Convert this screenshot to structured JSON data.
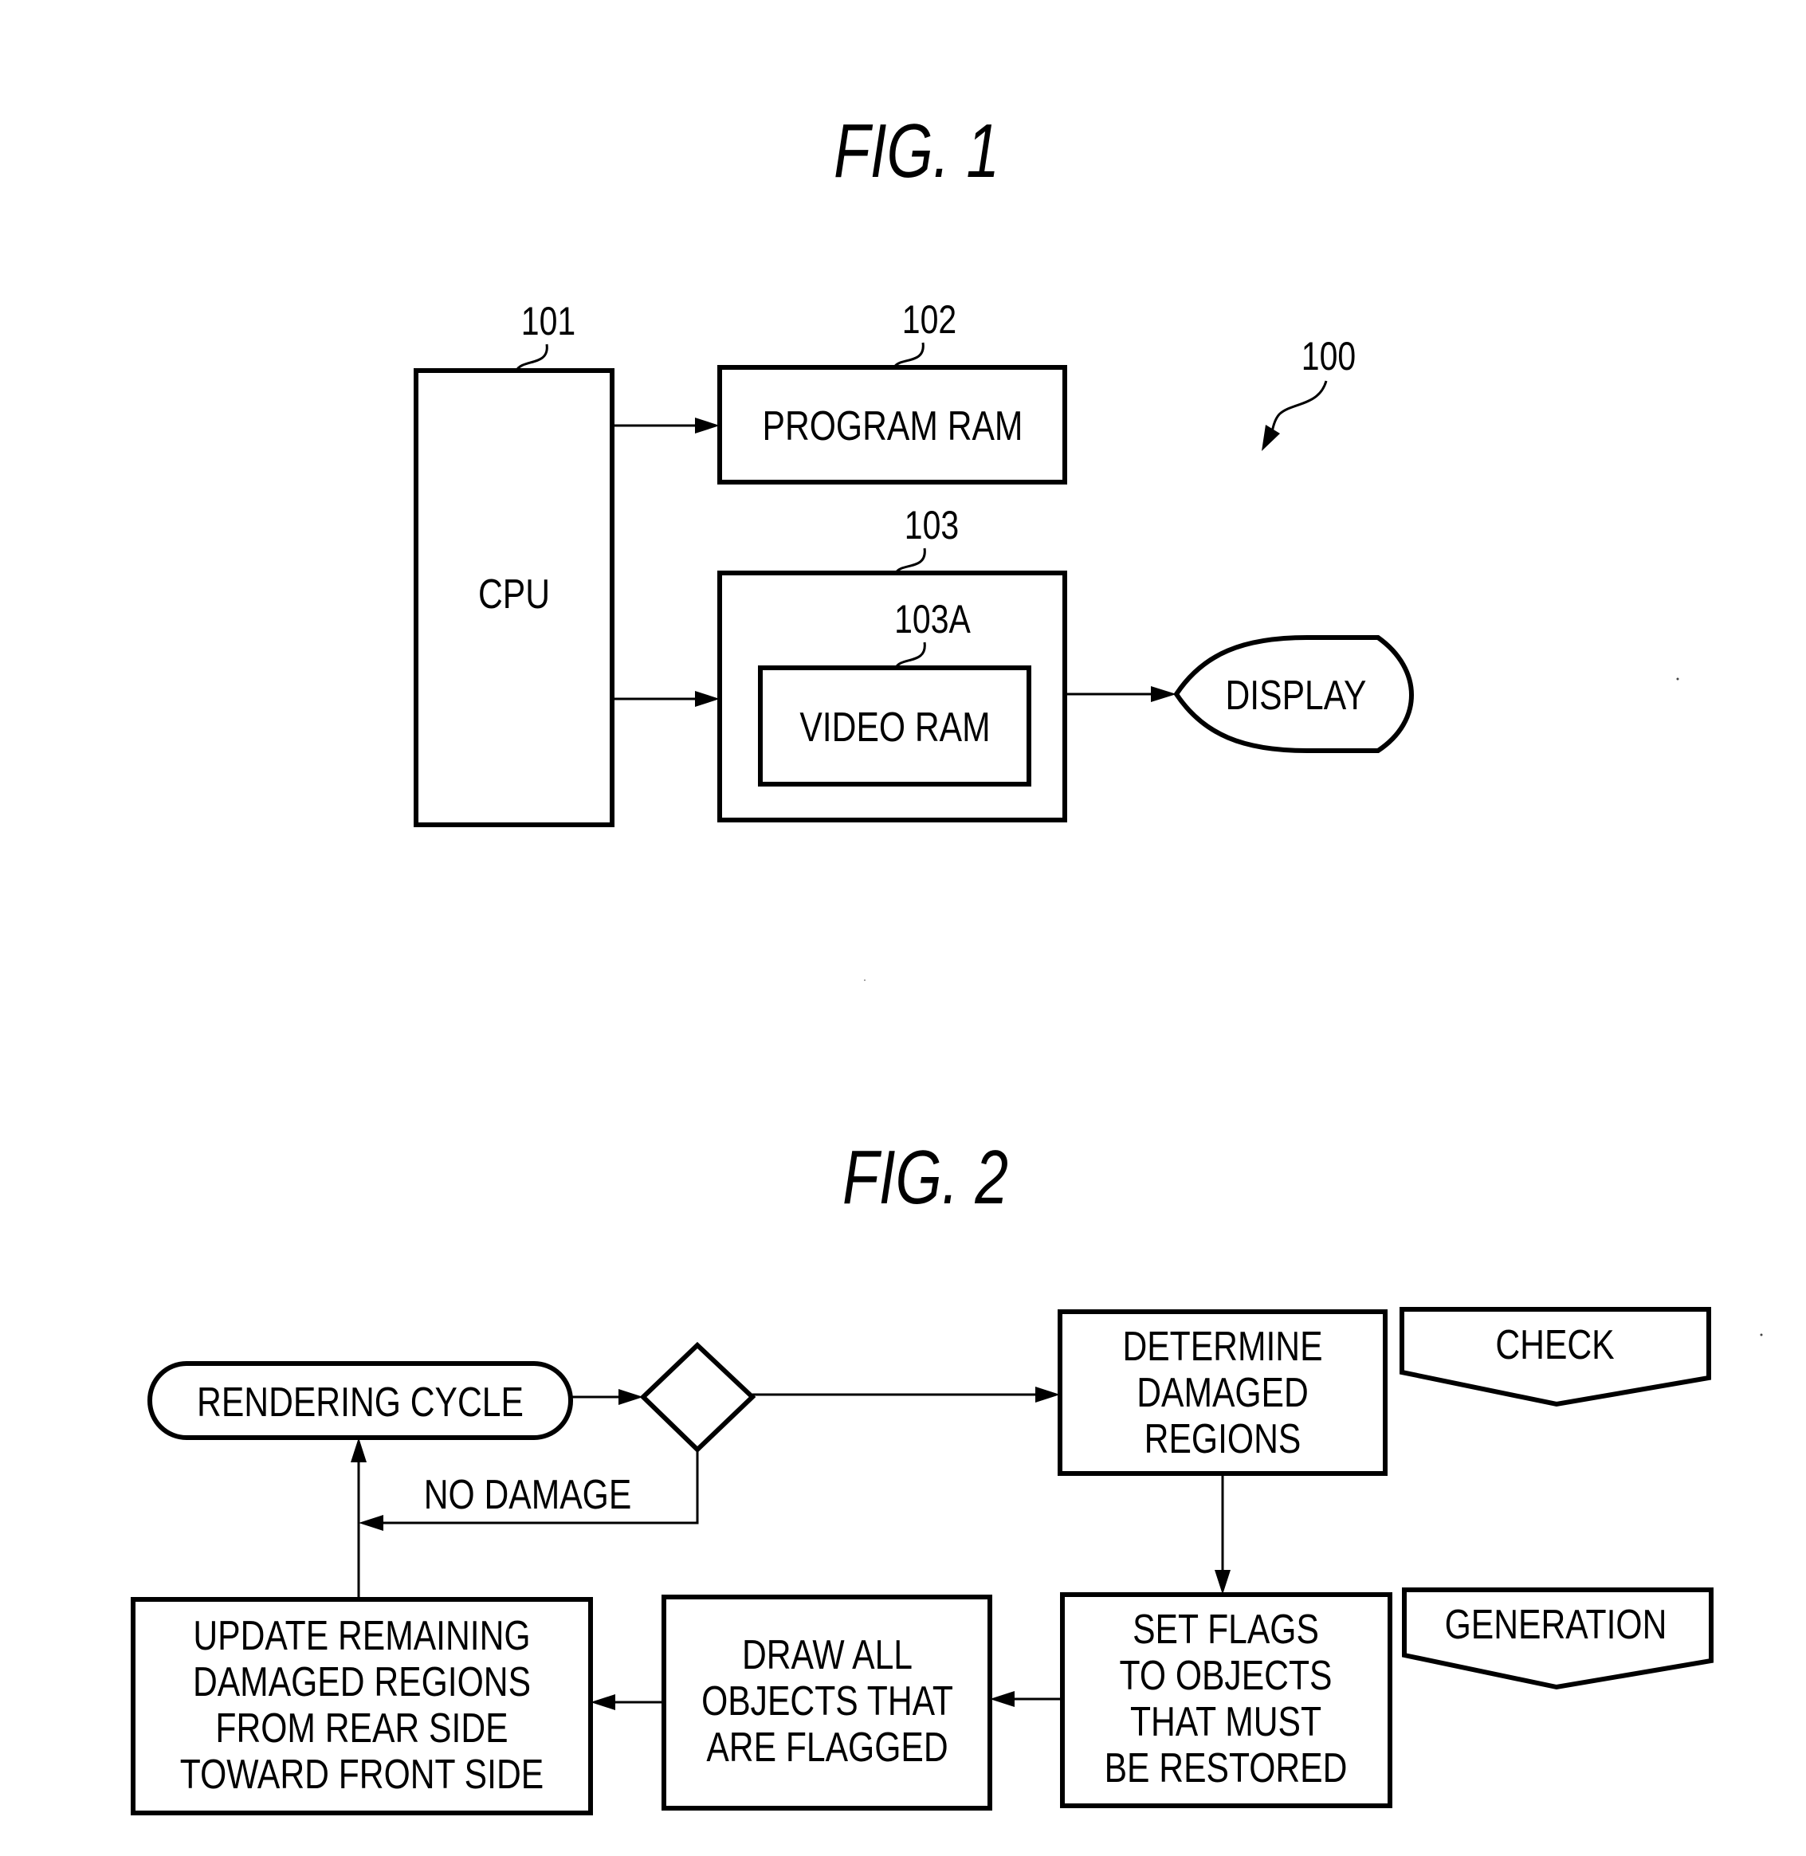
{
  "figure1": {
    "title": "FIG. 1",
    "system_ref": "100",
    "cpu": {
      "ref": "101",
      "label": "CPU"
    },
    "program_ram": {
      "ref": "102",
      "label": "PROGRAM RAM"
    },
    "video_block": {
      "ref": "103"
    },
    "video_ram": {
      "ref": "103A",
      "label": "VIDEO RAM"
    },
    "display": {
      "label": "DISPLAY"
    }
  },
  "figure2": {
    "title": "FIG. 2",
    "start": {
      "label": "RENDERING CYCLE"
    },
    "decision": {
      "branch_label": "NO DAMAGE"
    },
    "determine": {
      "lines": [
        "DETERMINE",
        "DAMAGED",
        "REGIONS"
      ]
    },
    "check_tag": {
      "label": "CHECK"
    },
    "set_flags": {
      "lines": [
        "SET FLAGS",
        "TO OBJECTS",
        "THAT MUST",
        "BE RESTORED"
      ]
    },
    "generation_tag": {
      "label": "GENERATION"
    },
    "draw": {
      "lines": [
        "DRAW ALL",
        "OBJECTS THAT",
        "ARE FLAGGED"
      ]
    },
    "update": {
      "lines": [
        "UPDATE REMAINING",
        "DAMAGED REGIONS",
        "FROM REAR SIDE",
        "TOWARD FRONT SIDE"
      ]
    }
  }
}
